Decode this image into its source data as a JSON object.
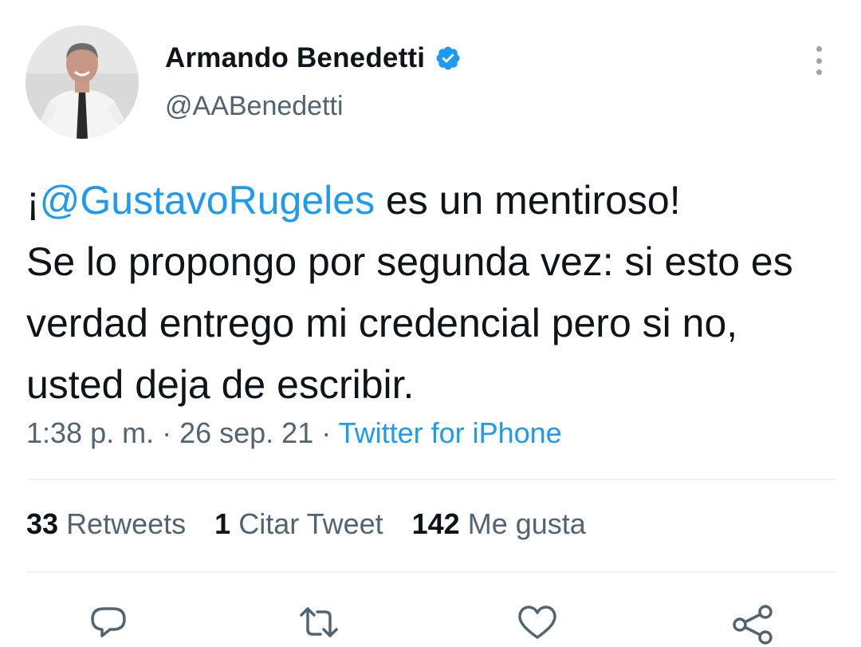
{
  "author": {
    "display_name": "Armando Benedetti",
    "handle": "@AABenedetti",
    "avatar_icon": "avatar-photo",
    "verified_icon": "verified-badge-icon"
  },
  "tweet": {
    "prefix": "¡",
    "mention": "@GustavoRugeles",
    "text_line1_rest": " es un mentiroso!",
    "text_rest": "Se lo propongo por segunda vez: si esto es verdad entrego mi credencial pero si no, usted deja de escribir."
  },
  "meta": {
    "time": "1:38 p. m.",
    "separator": " · ",
    "date": "26 sep. 21",
    "source": "Twitter for iPhone"
  },
  "stats": {
    "retweets_count": "33",
    "retweets_label": "Retweets",
    "quotes_count": "1",
    "quotes_label": "Citar Tweet",
    "likes_count": "142",
    "likes_label": "Me gusta"
  },
  "actions": [
    "reply-icon",
    "retweet-icon",
    "like-icon",
    "share-icon"
  ],
  "colors": {
    "accent": "#1d9bf0",
    "text": "#0f1419",
    "secondary": "#536471",
    "divider": "#eff3f4"
  }
}
